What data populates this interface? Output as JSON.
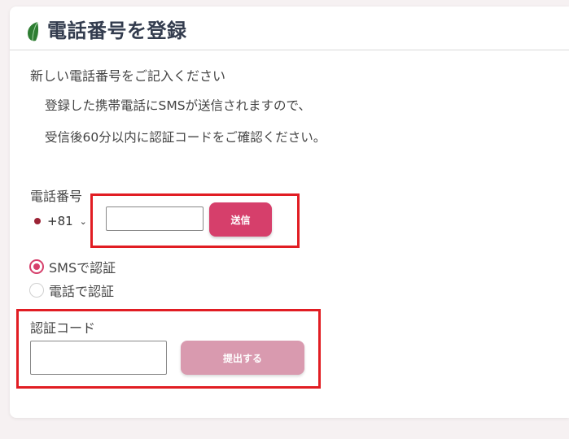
{
  "header": {
    "title": "電話番号を登録",
    "icon": "leaf-icon"
  },
  "intro": "新しい電話番号をご記入ください",
  "notes": [
    "登録した携帯電話にSMSが送信されますので、",
    "受信後60分以内に認証コードをご確認ください。"
  ],
  "phone": {
    "label": "電話番号",
    "country_code": "+81",
    "value": "",
    "send_label": "送信"
  },
  "verify_methods": [
    {
      "label": "SMSで認証",
      "selected": true
    },
    {
      "label": "電話で認証",
      "selected": false
    }
  ],
  "code": {
    "label": "認証コード",
    "value": "",
    "submit_label": "提出する"
  },
  "colors": {
    "accent": "#d63f6b",
    "accent_disabled": "#d99aaf",
    "highlight": "#e11d23",
    "title": "#333c4e"
  }
}
